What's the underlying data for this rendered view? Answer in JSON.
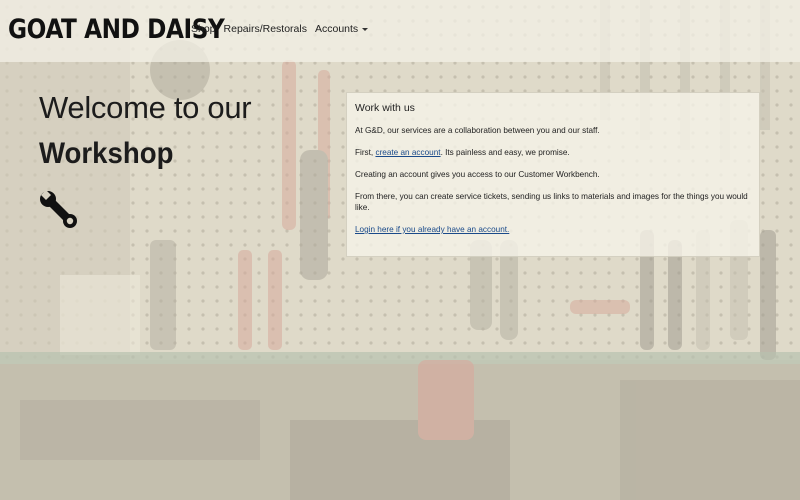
{
  "navbar": {
    "brand": "GOAT AND DAISY",
    "links": [
      {
        "label": "Shop"
      },
      {
        "label": "Repairs/Restorals"
      },
      {
        "label": "Accounts"
      }
    ]
  },
  "hero": {
    "line1": "Welcome to our",
    "line2": "Workshop",
    "icon": "wrench-icon"
  },
  "card": {
    "title": "Work with us",
    "p1": "At G&D, our services are a collaboration between you and our staff.",
    "p2_before": "First, ",
    "p2_link": "create an account",
    "p2_after": ". Its painless and easy, we promise.",
    "p3": "Creating an account gives you access to our Customer Workbench.",
    "p4": "From there, you can create service tickets, sending us links to materials and images for the things you would like.",
    "login_link": "Login here if you already have an account."
  },
  "colors": {
    "link": "#1a4a8a",
    "text": "#222222",
    "pegboard": "#c9c3b2",
    "overlay": "#f2eee0"
  }
}
